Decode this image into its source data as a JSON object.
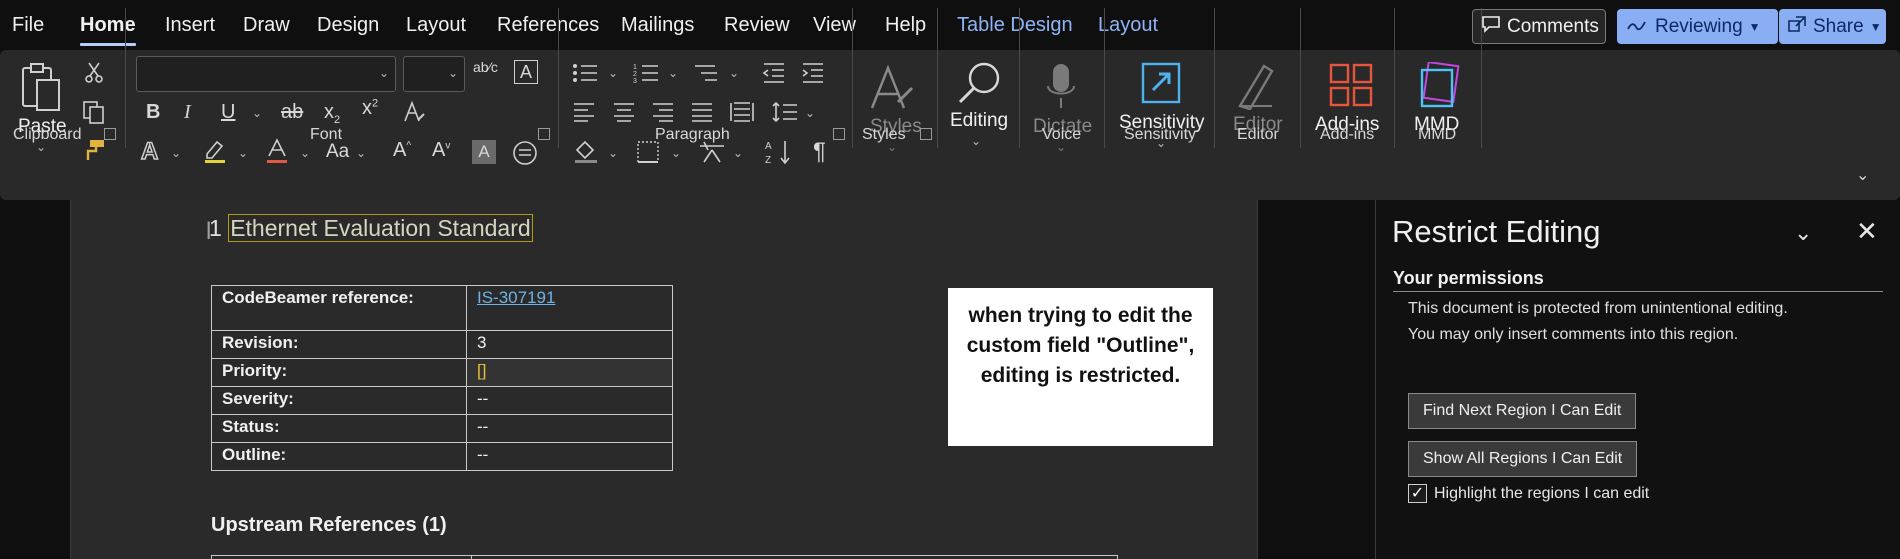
{
  "menu": {
    "items": [
      "File",
      "Home",
      "Insert",
      "Draw",
      "Design",
      "Layout",
      "References",
      "Mailings",
      "Review",
      "View",
      "Help"
    ],
    "contextual": [
      "Table Design",
      "Layout"
    ],
    "active": "Home",
    "comments_label": "Comments",
    "reviewing_label": "Reviewing",
    "share_label": "Share"
  },
  "ribbon": {
    "clipboard": {
      "paste_label": "Paste",
      "group_label": "Clipboard"
    },
    "font": {
      "group_label": "Font",
      "font_name": "",
      "font_size": ""
    },
    "paragraph": {
      "group_label": "Paragraph"
    },
    "styles": {
      "label": "Styles",
      "group_label": "Styles"
    },
    "editing": {
      "label": "Editing"
    },
    "voice": {
      "label": "Dictate",
      "group_label": "Voice"
    },
    "sensitivity": {
      "label": "Sensitivity",
      "group_label": "Sensitivity"
    },
    "editor": {
      "label": "Editor",
      "group_label": "Editor"
    },
    "addins": {
      "label": "Add-ins",
      "group_label": "Add-ins"
    },
    "mmd": {
      "label": "MMD",
      "group_label": "MMD"
    }
  },
  "document": {
    "heading_number": "1",
    "heading_text": "Ethernet Evaluation Standard",
    "table": [
      {
        "key": "CodeBeamer reference:",
        "value": "IS-307191"
      },
      {
        "key": "Revision:",
        "value": "3"
      },
      {
        "key": "Priority:",
        "value": "[]"
      },
      {
        "key": "Severity:",
        "value": "--"
      },
      {
        "key": "Status:",
        "value": "--"
      },
      {
        "key": "Outline:",
        "value": "--"
      }
    ],
    "note": "when trying to edit the custom field \"Outline\", editing is restricted.",
    "upstream_heading": "Upstream References (1)"
  },
  "pane": {
    "title": "Restrict Editing",
    "permissions_heading": "Your permissions",
    "line1": "This document is protected from unintentional editing.",
    "line2": "You may only insert comments into this region.",
    "find_next_label": "Find Next Region I Can Edit",
    "show_all_label": "Show All Regions I Can Edit",
    "highlight_label": "Highlight the regions I can edit",
    "highlight_checked": true
  },
  "colors": {
    "accent": "#8aaef4",
    "link": "#6fb3e6",
    "highlight_border": "#b19b10",
    "addins_icon": "#e8553e",
    "mmd_icon": "#4fc3f7"
  }
}
